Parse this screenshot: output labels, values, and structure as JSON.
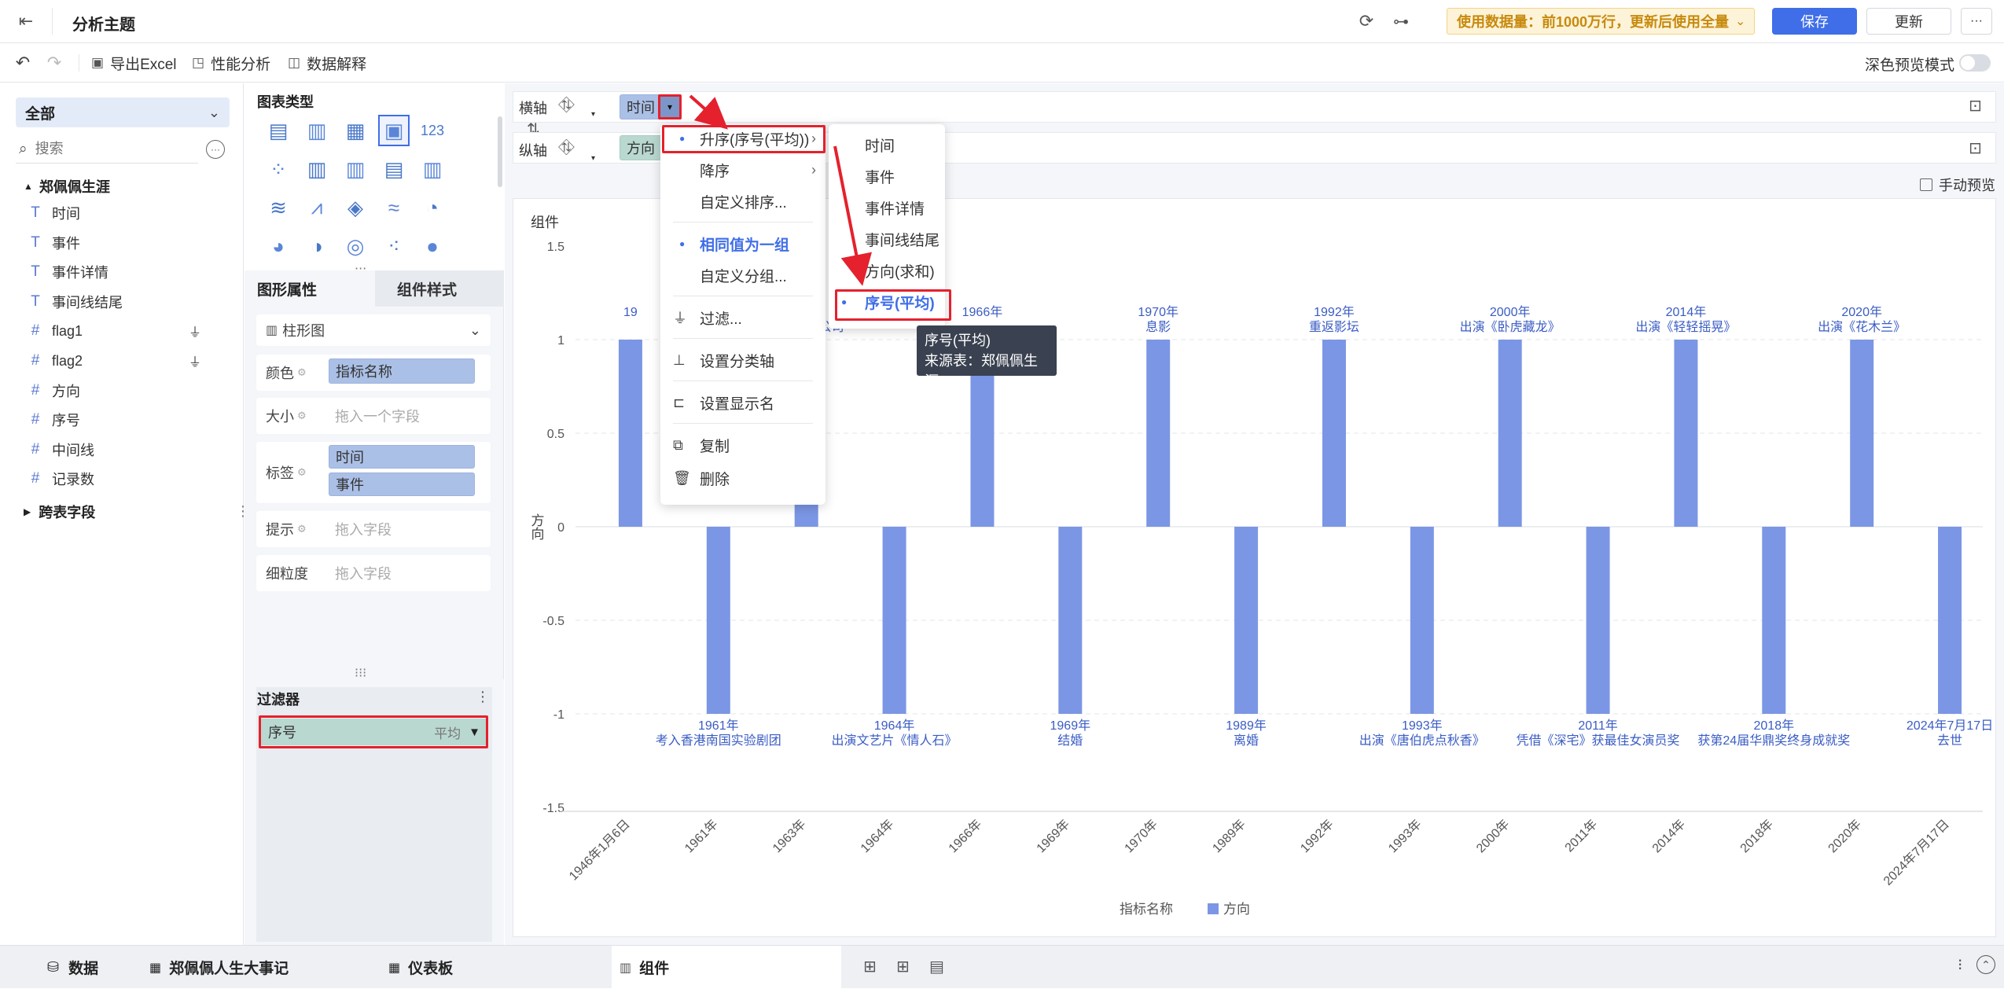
{
  "header": {
    "title": "分析主题",
    "usage_notice": "使用数据量：前1000万行，更新后使用全量",
    "save_label": "保存",
    "update_label": "更新",
    "more_label": "···"
  },
  "toolbar": {
    "export_excel": "导出Excel",
    "perf_analysis": "性能分析",
    "data_explain": "数据解释",
    "dark_preview": "深色预览模式"
  },
  "fields": {
    "scope": "全部",
    "search_placeholder": "搜索",
    "table_name": "郑佩佩生涯",
    "items": [
      {
        "type": "T",
        "label": "时间"
      },
      {
        "type": "T",
        "label": "事件"
      },
      {
        "type": "T",
        "label": "事件详情"
      },
      {
        "type": "T",
        "label": "事间线结尾"
      },
      {
        "type": "#",
        "label": "flag1"
      },
      {
        "type": "#",
        "label": "flag2"
      },
      {
        "type": "#",
        "label": "方向"
      },
      {
        "type": "#",
        "label": "序号"
      },
      {
        "type": "#",
        "label": "中间线"
      },
      {
        "type": "#",
        "label": "记录数"
      }
    ],
    "cross_table": "跨表字段"
  },
  "chart_types": {
    "title": "图表类型"
  },
  "properties": {
    "tab_graph": "图形属性",
    "tab_style": "组件样式",
    "chart_kind": "柱形图",
    "color_label": "颜色",
    "color_value": "指标名称",
    "size_label": "大小",
    "size_placeholder": "拖入一个字段",
    "label_label": "标签",
    "label_values": [
      "时间",
      "事件"
    ],
    "tip_label": "提示",
    "tip_placeholder": "拖入字段",
    "detail_label": "细粒度",
    "detail_placeholder": "拖入字段"
  },
  "filter": {
    "title": "过滤器",
    "item_name": "序号",
    "item_agg": "平均"
  },
  "axes": {
    "x_label": "横轴",
    "x_pill": "时间",
    "y_label": "纵轴",
    "y_pill": "方向",
    "manual_preview": "手动预览"
  },
  "component_title": "组件",
  "sort_menu": {
    "items": [
      "升序(序号(平均))",
      "降序",
      "自定义排序...",
      "相同值为一组",
      "自定义分组...",
      "过滤...",
      "设置分类轴",
      "设置显示名",
      "复制",
      "删除"
    ]
  },
  "sort_submenu": {
    "items": [
      "时间",
      "事件",
      "事件详情",
      "事间线结尾",
      "方向(求和)",
      "序号(平均)"
    ]
  },
  "tooltip": {
    "line1": "序号(平均)",
    "line2": "来源表：郑佩佩生涯"
  },
  "chart_data": {
    "type": "bar",
    "categories": [
      "1946年1月6日",
      "1961年",
      "1963年",
      "1964年",
      "1966年",
      "1969年",
      "1970年",
      "1989年",
      "1992年",
      "1993年",
      "2000年",
      "2011年",
      "2014年",
      "2018年",
      "2020年",
      "2024年7月17日"
    ],
    "series": [
      {
        "name": "方向",
        "values": [
          1,
          -1,
          1,
          -1,
          1,
          -1,
          1,
          -1,
          1,
          -1,
          1,
          -1,
          1,
          -1,
          1,
          -1
        ]
      }
    ],
    "events": [
      "",
      "考入香港南国实验剧团",
      "邵氏电影公司",
      "出演文艺片《情人石》",
      "",
      "结婚",
      "息影",
      "离婚",
      "重返影坛",
      "出演《唐伯虎点秋香》",
      "出演《卧虎藏龙》",
      "凭借《深宅》获最佳女演员奖",
      "出演《轻轻摇晃》",
      "获第24届华鼎奖终身成就奖",
      "出演《花木兰》",
      "去世"
    ],
    "label_years": [
      "19",
      "1961年",
      "",
      "1964年",
      "1966年",
      "1969年",
      "1970年",
      "1989年",
      "1992年",
      "1993年",
      "2000年",
      "2011年",
      "2014年",
      "2018年",
      "2020年",
      "2024年7月17日"
    ],
    "yticks": [
      "1.5",
      "1",
      "0.5",
      "0",
      "-0.5",
      "-1",
      "-1.5"
    ],
    "ylim": [
      -1.5,
      1.5
    ],
    "ylabel": "方向",
    "legend_title": "指标名称",
    "legend_item": "方向",
    "color": "#7b96e4"
  },
  "bottom_tabs": {
    "data": "数据",
    "dashboard1": "郑佩佩人生大事记",
    "dashboard2": "仪表板",
    "component": "组件"
  }
}
